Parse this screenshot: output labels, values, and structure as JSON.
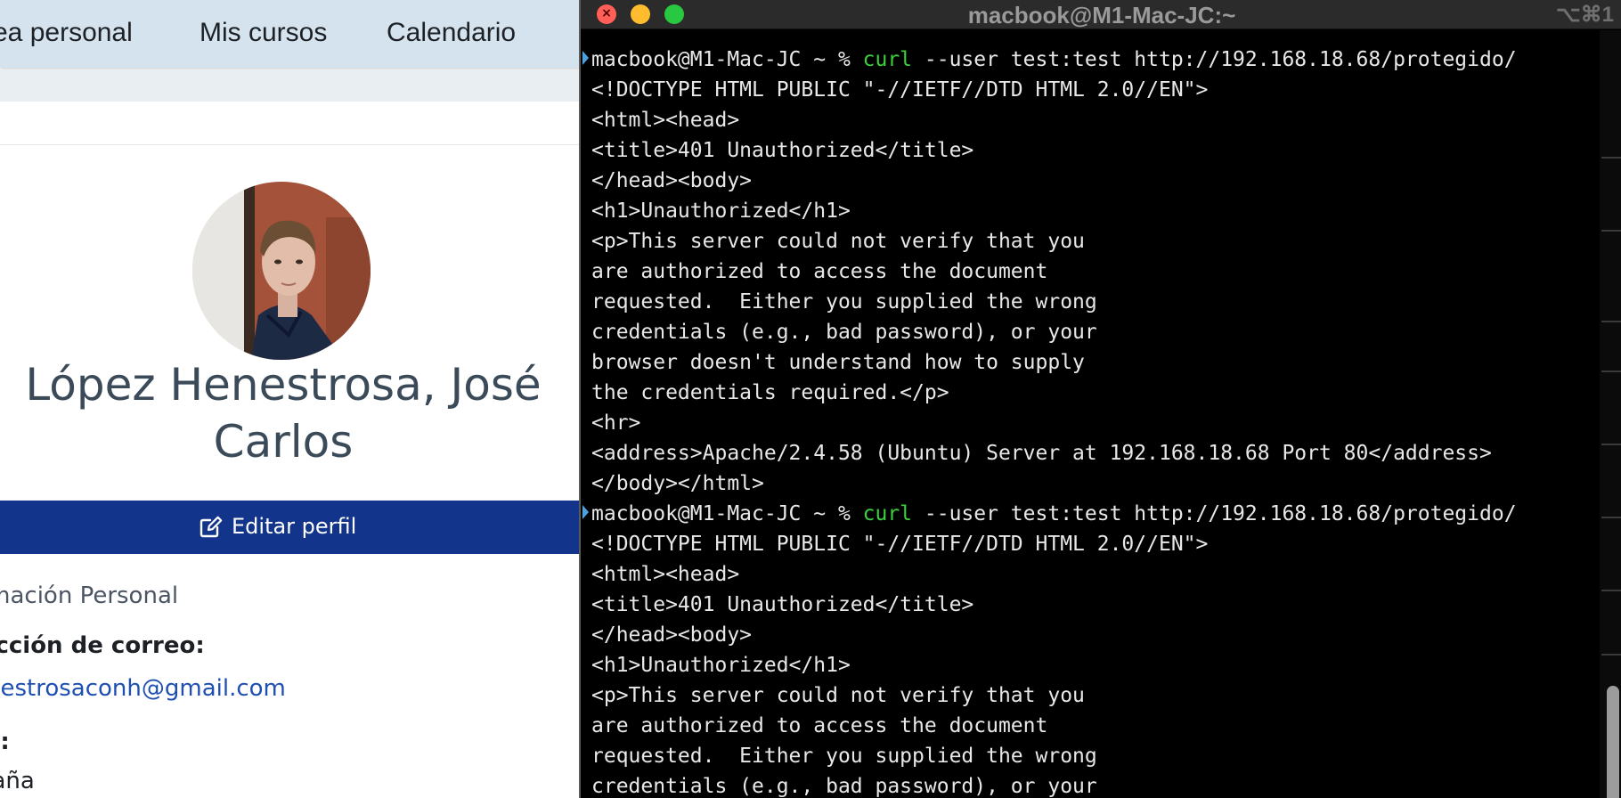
{
  "browser": {
    "nav": {
      "items": [
        {
          "label": "ea personal"
        },
        {
          "label": "Mis cursos"
        },
        {
          "label": "Calendario"
        }
      ]
    },
    "profile": {
      "name_line1": "López Henestrosa, José",
      "name_line2": "Carlos",
      "edit_button": "Editar perfil",
      "edit_icon": "edit-icon",
      "section_title": "ormación Personal",
      "email_label": "rección de correo:",
      "email_value": "nestrosaconh@gmail.com",
      "country_label": "ís:",
      "country_value": "paña"
    }
  },
  "terminal": {
    "title": "macbook@M1-Mac-JC:~",
    "shortcut": "⌥⌘1",
    "lines": [
      {
        "prompt": "macbook@M1-Mac-JC ~ % ",
        "cmd": "curl",
        "args": " --user test:test http://192.168.18.68/protegido/"
      },
      {
        "text": "<!DOCTYPE HTML PUBLIC \"-//IETF//DTD HTML 2.0//EN\">"
      },
      {
        "text": "<html><head>"
      },
      {
        "text": "<title>401 Unauthorized</title>"
      },
      {
        "text": "</head><body>"
      },
      {
        "text": "<h1>Unauthorized</h1>"
      },
      {
        "text": "<p>This server could not verify that you"
      },
      {
        "text": "are authorized to access the document"
      },
      {
        "text": "requested.  Either you supplied the wrong"
      },
      {
        "text": "credentials (e.g., bad password), or your"
      },
      {
        "text": "browser doesn't understand how to supply"
      },
      {
        "text": "the credentials required.</p>"
      },
      {
        "text": "<hr>"
      },
      {
        "text": "<address>Apache/2.4.58 (Ubuntu) Server at 192.168.18.68 Port 80</address>"
      },
      {
        "text": "</body></html>"
      },
      {
        "prompt": "macbook@M1-Mac-JC ~ % ",
        "cmd": "curl",
        "args": " --user test:test http://192.168.18.68/protegido/"
      },
      {
        "text": "<!DOCTYPE HTML PUBLIC \"-//IETF//DTD HTML 2.0//EN\">"
      },
      {
        "text": "<html><head>"
      },
      {
        "text": "<title>401 Unauthorized</title>"
      },
      {
        "text": "</head><body>"
      },
      {
        "text": "<h1>Unauthorized</h1>"
      },
      {
        "text": "<p>This server could not verify that you"
      },
      {
        "text": "are authorized to access the document"
      },
      {
        "text": "requested.  Either you supplied the wrong"
      },
      {
        "text": "credentials (e.g., bad password), or your"
      }
    ]
  },
  "colors": {
    "nav_bg": "#d4e3ee",
    "edit_button_bg": "#12348a",
    "link": "#1f4fb2",
    "terminal_bg": "#000000",
    "command": "#3cd13c"
  }
}
